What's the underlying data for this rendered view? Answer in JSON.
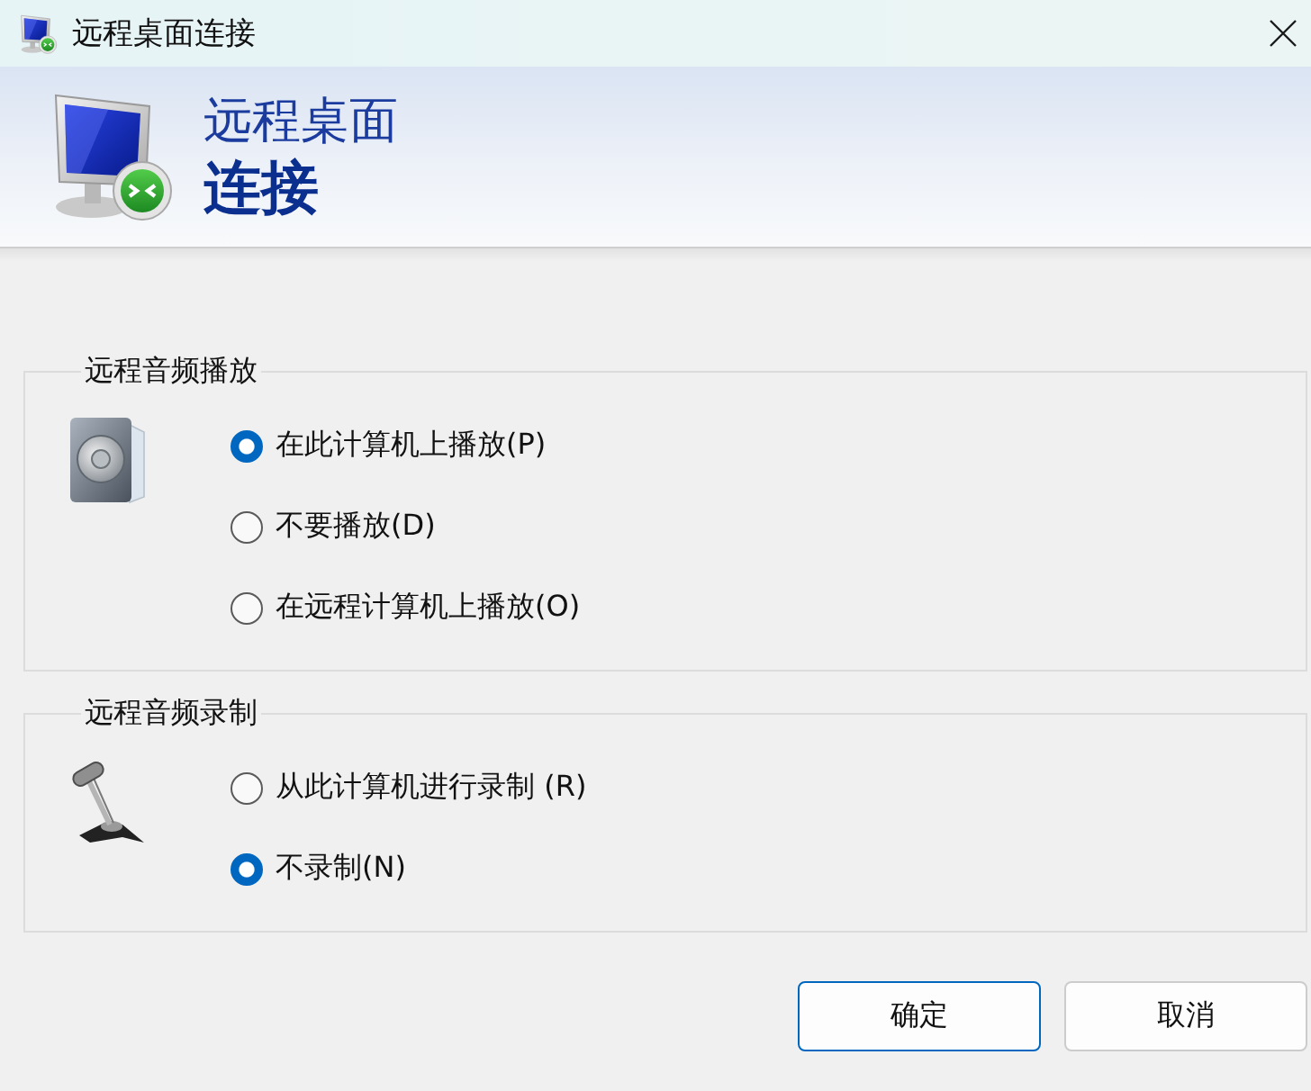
{
  "window": {
    "title": "远程桌面连接"
  },
  "banner": {
    "line_1": "远程桌面",
    "line_2": "连接"
  },
  "groups": [
    {
      "title": "远程音频播放",
      "kind": "speaker",
      "options": [
        {
          "label": "在此计算机上播放(P)",
          "selected": true
        },
        {
          "label": "不要播放(D)",
          "selected": false
        },
        {
          "label": "在远程计算机上播放(O)",
          "selected": false
        }
      ]
    },
    {
      "title": "远程音频录制",
      "kind": "microphone",
      "options": [
        {
          "label": "从此计算机进行录制 (R)",
          "selected": false
        },
        {
          "label": "不录制(N)",
          "selected": true
        }
      ]
    }
  ],
  "buttons": [
    {
      "label": "确定",
      "focused": true
    },
    {
      "label": "取消",
      "focused": false
    }
  ]
}
